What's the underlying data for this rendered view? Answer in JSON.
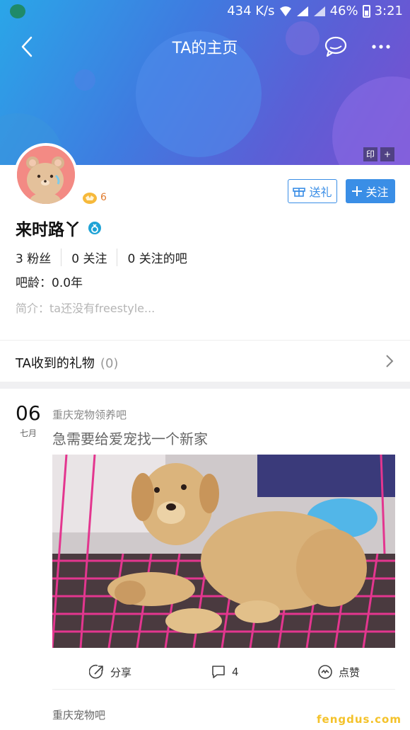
{
  "status_bar": {
    "speed": "434 K/s",
    "battery": "46%",
    "time": "3:21"
  },
  "nav": {
    "title": "TA的主页"
  },
  "header_tools": {
    "stamp_label": "印",
    "add_label": "+"
  },
  "profile": {
    "level": "6",
    "username": "来时路丫",
    "stats": {
      "fans_count": "3",
      "fans_label": "粉丝",
      "following_count": "0",
      "following_label": "关注",
      "forums_count": "0",
      "forums_label": "关注的吧"
    },
    "age": "吧龄：0.0年",
    "bio": "简介：ta还没有freestyle..."
  },
  "buttons": {
    "gift": "送礼",
    "follow": "关注"
  },
  "gifts": {
    "label": "TA收到的礼物",
    "count": "(0)"
  },
  "post": {
    "day": "06",
    "month": "七月",
    "forum": "重庆宠物领养吧",
    "title": "急需要给爱宠找一个新家",
    "share_label": "分享",
    "comment_count": "4",
    "like_label": "点赞"
  },
  "next_post": {
    "forum": "重庆宠物吧"
  },
  "watermark": "fengdus.com",
  "colors": {
    "accent": "#3a8ee6",
    "level": "#e07b2e"
  }
}
